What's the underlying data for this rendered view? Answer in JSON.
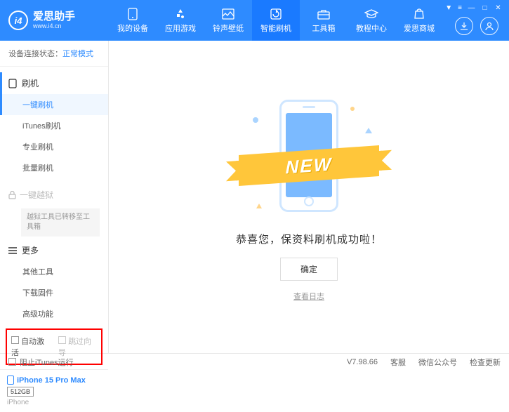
{
  "app": {
    "title": "爱思助手",
    "url": "www.i4.cn"
  },
  "nav": {
    "items": [
      {
        "label": "我的设备"
      },
      {
        "label": "应用游戏"
      },
      {
        "label": "铃声壁纸"
      },
      {
        "label": "智能刷机"
      },
      {
        "label": "工具箱"
      },
      {
        "label": "教程中心"
      },
      {
        "label": "爱思商城"
      }
    ]
  },
  "sidebar": {
    "status_label": "设备连接状态：",
    "status_value": "正常模式",
    "flash_header": "刷机",
    "flash_items": [
      "一键刷机",
      "iTunes刷机",
      "专业刷机",
      "批量刷机"
    ],
    "jailbreak_header": "一键越狱",
    "jailbreak_note": "越狱工具已转移至工具箱",
    "more_header": "更多",
    "more_items": [
      "其他工具",
      "下载固件",
      "高级功能"
    ],
    "checkbox1": "自动激活",
    "checkbox2": "跳过向导",
    "device": {
      "name": "iPhone 15 Pro Max",
      "storage": "512GB",
      "type": "iPhone"
    }
  },
  "main": {
    "ribbon": "NEW",
    "message": "恭喜您，保资料刷机成功啦！",
    "confirm": "确定",
    "log_link": "查看日志"
  },
  "footer": {
    "block_itunes": "阻止iTunes运行",
    "version": "V7.98.66",
    "links": [
      "客服",
      "微信公众号",
      "检查更新"
    ]
  }
}
